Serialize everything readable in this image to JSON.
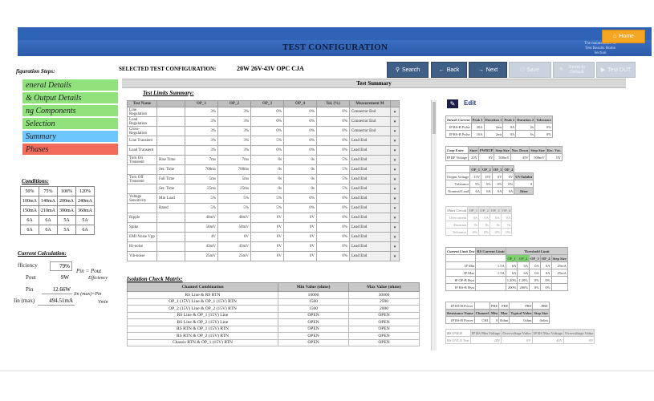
{
  "header": {
    "title": "TEST CONFIGURATION",
    "subtitle": "The maintenance of Test Results Home Section",
    "home_label": "Home"
  },
  "selected": {
    "label": "SELECTED TEST CONFIGURATION:",
    "value": "20W 26V-43V OPC CJA"
  },
  "toolbar": {
    "search": "Search",
    "back": "Back",
    "next": "Next",
    "save": "Save",
    "reset": "Reset to Default",
    "test": "Test DUT"
  },
  "summary_bar": "Test Summary",
  "steps": {
    "heading": "figuration Steps:",
    "items": [
      {
        "label": "eneral Details",
        "color": "#8fe27c"
      },
      {
        "label": "& Output Details",
        "color": "#8fe27c"
      },
      {
        "label": "ng Components",
        "color": "#8fe27c"
      },
      {
        "label": "Selection",
        "color": "#8fe27c"
      },
      {
        "label": "Summary",
        "color": "#6ec6ff"
      },
      {
        "label": "Phases",
        "color": "#f26b5b"
      }
    ]
  },
  "conditions": {
    "heading": "Conditions:",
    "rows": [
      [
        "50%",
        "75%",
        "100%",
        "120%"
      ],
      [
        "100mA",
        "140mA",
        "200mA",
        "240mA"
      ],
      [
        "150mA",
        "210mA",
        "300mA",
        "360mA"
      ],
      [
        "6A",
        "6A",
        "5A",
        "5A"
      ],
      [
        "6A",
        "6A",
        "5A",
        "6A"
      ]
    ]
  },
  "current_calc": {
    "heading": "Current Calculation:",
    "efficiency_label": "fficiency",
    "efficiency_value": "79%",
    "pout_label": "Pout",
    "pout_value": "9W",
    "pin_label": "Pin",
    "pin_value": "12.66W",
    "iin_label": "Iin (max)",
    "iin_value": "494.51mA",
    "formula1": "Pin = Pout",
    "formula1b": "Efficiency",
    "formula2": "Iin (max)=Pin",
    "formula2b": "Vmin"
  },
  "limits": {
    "heading": "Test Limits Summary:",
    "columns": [
      "Test Name",
      "",
      "OP_1",
      "OP_2",
      "OP_3",
      "OP_4",
      "Tol. (%)",
      "Measurement M",
      ""
    ],
    "rows": [
      {
        "name": "Line Regulation",
        "sub": "",
        "v": [
          "3%",
          "3%",
          "0%",
          "0%",
          "0%"
        ],
        "m": "Connector End"
      },
      {
        "name": "Load Regulation",
        "sub": "",
        "v": [
          "3%",
          "3%",
          "0%",
          "0%",
          "0%"
        ],
        "m": "Connector End"
      },
      {
        "name": "Cross-Regulation",
        "sub": "",
        "v": [
          "3%",
          "3%",
          "0%",
          "0%",
          "0%"
        ],
        "m": "Connector End"
      },
      {
        "name": "Line Transient",
        "sub": "",
        "v": [
          "3%",
          "3%",
          "5%",
          "0%",
          "0%"
        ],
        "m": "Lead End"
      },
      {
        "name": "Load Transient",
        "sub": "",
        "v": [
          "3%",
          "3%",
          "0%",
          "0%",
          "0%"
        ],
        "m": "Lead End"
      },
      {
        "name": "Turn On Transient",
        "sub": "Rise Time",
        "v": [
          "7ms",
          "7ms",
          "0s",
          "0s",
          "5%"
        ],
        "m": "Lead End"
      },
      {
        "name": "",
        "sub": "Set. Time",
        "v": [
          "700ms",
          "700ms",
          "0s",
          "0s",
          "5%"
        ],
        "m": "Lead End"
      },
      {
        "name": "Turn Off Transient",
        "sub": "Fall Time",
        "v": [
          "5ms",
          "5ms",
          "0s",
          "0s",
          "5%"
        ],
        "m": "Lead End"
      },
      {
        "name": "",
        "sub": "Set. Time",
        "v": [
          "25ms",
          "25ms",
          "0s",
          "0s",
          "5%"
        ],
        "m": "Lead End"
      },
      {
        "name": "Voltage Sensitivity",
        "sub": "Min Load",
        "v": [
          "5%",
          "5%",
          "5%",
          "0%",
          "0%"
        ],
        "m": "Lead End"
      },
      {
        "name": "",
        "sub": "Rated",
        "v": [
          "5%",
          "5%",
          "5%",
          "0%",
          "0%"
        ],
        "m": "Lead End"
      },
      {
        "name": "Ripple",
        "sub": "",
        "v": [
          "40mV",
          "40mV",
          "0V",
          "0V",
          "0%"
        ],
        "m": "Lead End"
      },
      {
        "name": "Spike",
        "sub": "",
        "v": [
          "50mV",
          "50mV",
          "0V",
          "0V",
          "0%"
        ],
        "m": "Lead End"
      },
      {
        "name": "EMI Noise Vpp",
        "sub": "",
        "v": [
          "4V",
          "0V",
          "0V",
          "0V",
          "0%"
        ],
        "m": "Lead End"
      },
      {
        "name": "Hi-noise",
        "sub": "",
        "v": [
          "43mV",
          "43mV",
          "0V",
          "0V",
          "0%"
        ],
        "m": "Lead End"
      },
      {
        "name": "Vib-noise",
        "sub": "",
        "v": [
          "25mV",
          "25mV",
          "0V",
          "0V",
          "0%"
        ],
        "m": "Lead End"
      }
    ]
  },
  "isolation": {
    "heading": "Isolation Check Matrix:",
    "columns": [
      "Channel Combination",
      "Min Value (ohms)",
      "Max Value (ohms)"
    ],
    "rows": [
      [
        "RS Line & RS RTN",
        "10000",
        "30000"
      ],
      [
        "OP_1 (15V) Line & OP_1 (15V) RTN",
        "1500",
        "2500"
      ],
      [
        "OP_2 (15V) Line & OP_2 (15V) RTN",
        "1500",
        "2000"
      ],
      [
        "RS Line & OP_1 (15V) Line",
        "OPEN",
        "OPEN"
      ],
      [
        "RS Line & OP_2 (15V) Line",
        "OPEN",
        "OPEN"
      ],
      [
        "RS RTN & OP_1 (15V) RTN",
        "OPEN",
        "OPEN"
      ],
      [
        "RS RTN & OP_2 (15V) RTN",
        "OPEN",
        "OPEN"
      ],
      [
        "Chassis RTN & OP_1 (15V) RTN",
        "OPEN",
        "OPEN"
      ]
    ]
  },
  "right": {
    "edit_label": "Edit",
    "inrush": {
      "heading": "Inrush Current",
      "cols": [
        "Peak 1",
        "Duration 1",
        "Peak 2",
        "Duration 2",
        "Tolerance"
      ],
      "rows": [
        [
          "IP RS-B Pulse",
          "20A",
          "2ms",
          "0A",
          "0s",
          "0%"
        ],
        [
          "IP RS-B Pulse",
          "10A",
          "2ms",
          "0A",
          "0s",
          "0%"
        ]
      ]
    },
    "loop": {
      "heading": "Loop Entry",
      "cols": [
        "Start",
        "PWRUP",
        "Step Size",
        "Nor. Down",
        "Step Size",
        "Rec. Vot."
      ],
      "row": [
        "IP RF Voltage",
        "20V",
        "0V",
        "500mV",
        "45V",
        "500mV",
        "0V"
      ]
    },
    "outputs": {
      "cols": [
        "OP_1",
        "OP_2",
        "OP_3",
        "OP_4"
      ],
      "rows": [
        [
          "Output Voltage",
          "15V",
          "15V",
          "0V",
          "0V"
        ],
        [
          "Tolerance",
          "5%",
          "5%",
          "0%",
          "0%"
        ],
        [
          "Nominal Load",
          "6A",
          "6A",
          "0A",
          "0A"
        ]
      ],
      "extra1": "UV/Inhibit",
      "extra2": "0",
      "extra3": "Jitter"
    },
    "short": {
      "heading": "Short Circuit",
      "cols": [
        "OP_1",
        "OP_2",
        "OP_3",
        "OP_4"
      ],
      "rows": [
        [
          "Overcurrent",
          "0A",
          "0A",
          "0A",
          "0A"
        ],
        [
          "Duration",
          "0s",
          "0s",
          "0s",
          "0s"
        ],
        [
          "Tolerance",
          "0%",
          "0%",
          "0%",
          "0%"
        ]
      ]
    },
    "ocl": {
      "heading": "Current Limit Test",
      "rs_label": "RS Current Limit",
      "threshold": "Threshold Limit",
      "cols": [
        "OP_1",
        "OP_2",
        "OP_3",
        "OP_4",
        "Step Size"
      ],
      "rows": [
        [
          "IP Min",
          "1.5A",
          "6A",
          "6A",
          "0A",
          "0A",
          "25mA"
        ],
        [
          "IP Max",
          "1.5A",
          "6A",
          "6A",
          "0A",
          "0A",
          "25mA"
        ],
        [
          "IP OP-B Hyst",
          "",
          "1.20%",
          "1.20%",
          "0%",
          "0%",
          ""
        ],
        [
          "IP RS-B Hyst",
          "",
          "200%",
          "200%",
          "0%",
          "0%",
          ""
        ]
      ]
    },
    "step": {
      "row1": [
        "IP RS-B Power",
        "",
        "PRE",
        "PRE",
        "PRE",
        "PRE"
      ],
      "cols2": [
        "Resistance Name",
        "Channel",
        "Min",
        "Max",
        "Typical Value",
        "Step Size"
      ],
      "row2": [
        "IP RS-B Power",
        "CH1",
        "0",
        "0ohm",
        "0ohm",
        "0ohm"
      ]
    },
    "rsulo": {
      "heading": "RS UVLO",
      "cols": [
        "IP RS Min Voltage",
        "Overvoltage Value",
        "IP RS Max Voltage",
        "Overvoltage Value"
      ],
      "row": [
        "RS UVLO Test",
        "28V",
        "0V",
        "40V",
        "0V"
      ]
    }
  }
}
